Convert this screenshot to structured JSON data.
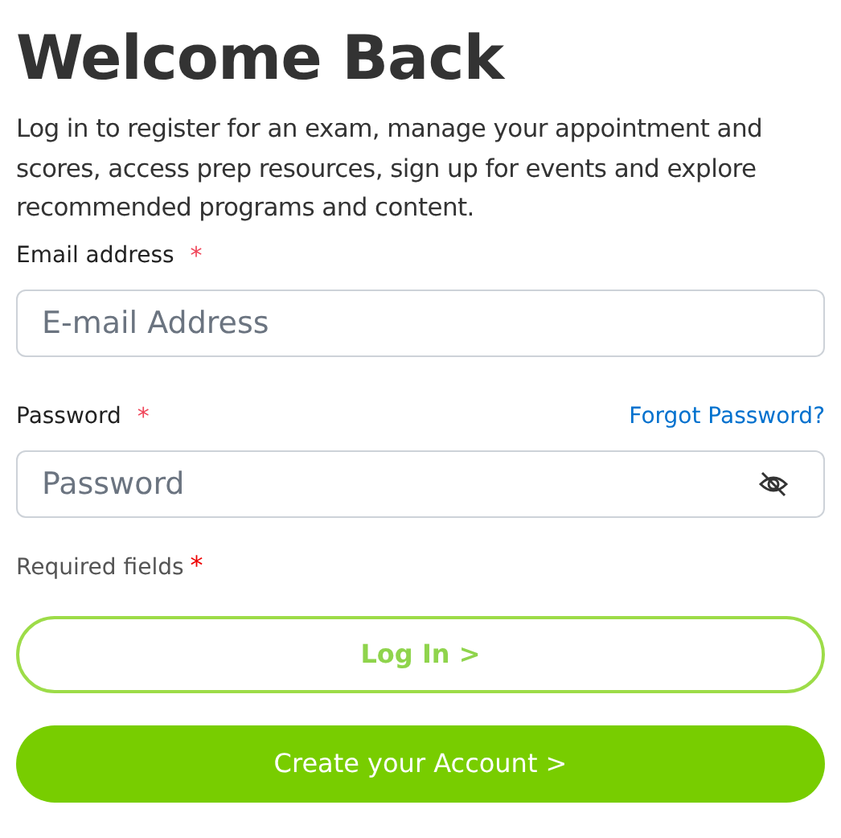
{
  "title": "Welcome Back",
  "intro": "Log in to register for an exam, manage your appointment and scores, access prep resources, sign up for events and explore recommended programs and content.",
  "fields": [
    {
      "kind": "email",
      "label": "Email address",
      "required_mark": "*",
      "placeholder": "E-mail Address"
    },
    {
      "kind": "password",
      "label": "Password",
      "required_mark": "*",
      "link": "Forgot Password?",
      "placeholder": "Password"
    }
  ],
  "required_note": {
    "text": "Required fields",
    "mark": "*"
  },
  "buttons": [
    {
      "kind": "outline",
      "label": "Log In >"
    },
    {
      "kind": "filled",
      "label": "Create your Account >"
    }
  ]
}
